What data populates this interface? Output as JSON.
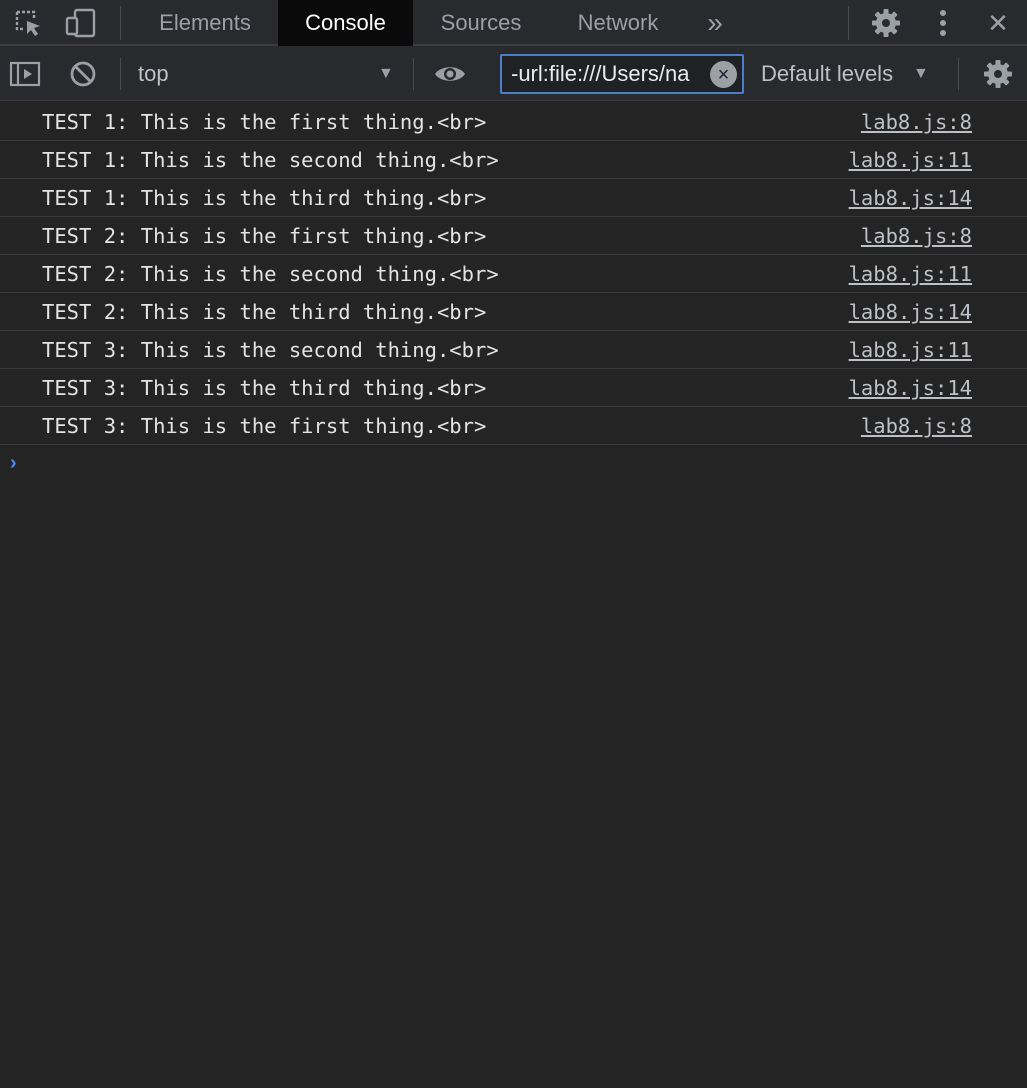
{
  "tabs": [
    {
      "label": "Elements",
      "active": false
    },
    {
      "label": "Console",
      "active": true
    },
    {
      "label": "Sources",
      "active": false
    },
    {
      "label": "Network",
      "active": false
    }
  ],
  "more_tabs_glyph": "»",
  "close_glyph": "✕",
  "toolbar": {
    "context": "top",
    "filter_value": "-url:file:///Users/na",
    "levels": "Default levels",
    "dropdown_glyph": "▼"
  },
  "messages": [
    {
      "text": "TEST 1: This is the first thing.<br>",
      "source": "lab8.js:8"
    },
    {
      "text": "TEST 1: This is the second thing.<br>",
      "source": "lab8.js:11"
    },
    {
      "text": "TEST 1: This is the third thing.<br>",
      "source": "lab8.js:14"
    },
    {
      "text": "TEST 2: This is the first thing.<br>",
      "source": "lab8.js:8"
    },
    {
      "text": "TEST 2: This is the second thing.<br>",
      "source": "lab8.js:11"
    },
    {
      "text": "TEST 2: This is the third thing.<br>",
      "source": "lab8.js:14"
    },
    {
      "text": "TEST 3: This is the second thing.<br>",
      "source": "lab8.js:11"
    },
    {
      "text": "TEST 3: This is the third thing.<br>",
      "source": "lab8.js:14"
    },
    {
      "text": "TEST 3: This is the first thing.<br>",
      "source": "lab8.js:8"
    }
  ],
  "prompt_glyph": "›",
  "colors": {
    "accent": "#4b8df8",
    "background": "#242424",
    "toolbar": "#292a2d",
    "active_tab": "#0a0a0a"
  },
  "icons": [
    "inspect-element-icon",
    "device-toolbar-icon",
    "settings-gear-icon",
    "kebab-menu-icon",
    "close-icon",
    "sidebar-toggle-icon",
    "clear-console-icon",
    "eye-icon",
    "filter-clear-icon",
    "console-settings-icon"
  ]
}
